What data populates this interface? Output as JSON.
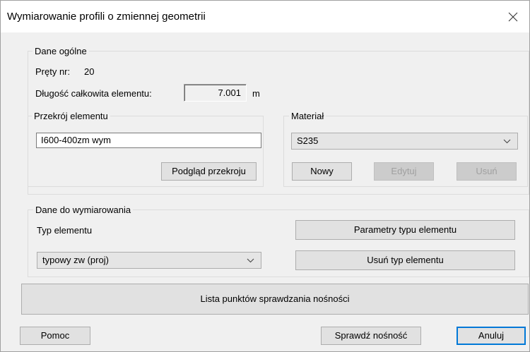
{
  "window": {
    "title": "Wymiarowanie profili o zmiennej geometrii"
  },
  "general": {
    "legend": "Dane ogólne",
    "bars_label": "Pręty nr:",
    "bars_value": "20",
    "length_label": "Długość całkowita elementu:",
    "length_value": "7.001",
    "length_unit": "m"
  },
  "section": {
    "legend": "Przekrój elementu",
    "value": "I600-400zm wym",
    "preview_button": "Podgląd przekroju"
  },
  "material": {
    "legend": "Materiał",
    "selected": "S235",
    "new_button": "Nowy",
    "edit_button": "Edytuj",
    "delete_button": "Usuń"
  },
  "design": {
    "legend": "Dane do wymiarowania",
    "type_label": "Typ elementu",
    "type_selected": "typowy zw (proj)",
    "params_button": "Parametry typu elementu",
    "delete_type_button": "Usuń typ elementu"
  },
  "check_points_button": "Lista punktów sprawdzania nośności",
  "footer": {
    "help_button": "Pomoc",
    "check_button": "Sprawdź nośność",
    "cancel_button": "Anuluj"
  },
  "icons": {
    "close": "close-icon",
    "dropdown": "chevron-down-icon"
  },
  "colors": {
    "accent": "#0078d7",
    "disabled_text": "#a0a0a0"
  }
}
